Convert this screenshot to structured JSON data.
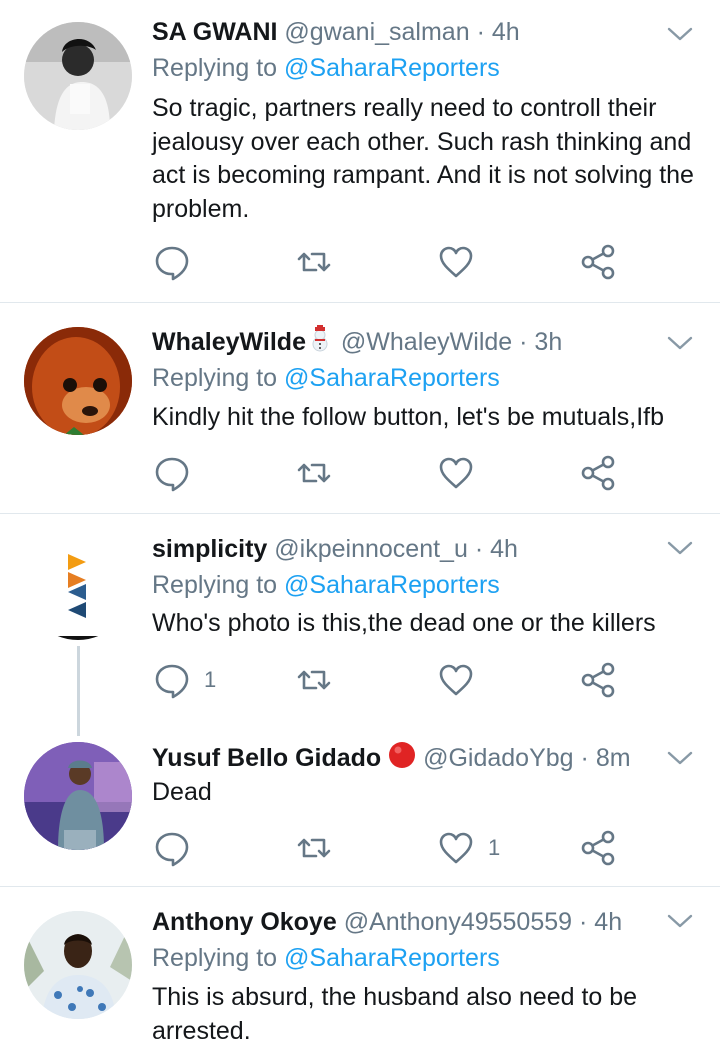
{
  "tweets": [
    {
      "name": "SA GWANI",
      "handle": "@gwani_salman",
      "time": "4h",
      "reply_prefix": "Replying to",
      "reply_to": "@SaharaReporters",
      "text": "So tragic, partners really need to controll their jealousy over each other. Such rash thinking and act is becoming rampant. And it is not solving the problem.",
      "reply_count": "",
      "like_count": ""
    },
    {
      "name": "WhaleyWilde",
      "name_emoji": "snowman-emoji",
      "handle": "@WhaleyWilde",
      "time": "3h",
      "reply_prefix": "Replying to",
      "reply_to": "@SaharaReporters",
      "text": "Kindly hit the follow button, let's be mutuals,Ifb",
      "reply_count": "",
      "like_count": ""
    },
    {
      "name": "simplicity",
      "handle": "@ikpeinnocent_u",
      "time": "4h",
      "reply_prefix": "Replying to",
      "reply_to": "@SaharaReporters",
      "text": "Who's photo is this,the dead one or the killers",
      "reply_count": "1",
      "like_count": ""
    },
    {
      "name": "Yusuf Bello Gidado",
      "name_emoji": "red-circle-emoji",
      "handle": "@GidadoYbg",
      "time": "8m",
      "text": "Dead",
      "reply_count": "",
      "like_count": "1"
    },
    {
      "name": "Anthony Okoye",
      "handle": "@Anthony49550559",
      "time": "4h",
      "reply_prefix": "Replying to",
      "reply_to": "@SaharaReporters",
      "text": "This is absurd, the husband also need to be arrested.",
      "reply_count": "",
      "like_count": ""
    }
  ],
  "separator_dot": "·",
  "colors": {
    "link": "#1da1f2",
    "secondary": "#657786",
    "text": "#14171a",
    "divider": "#e1e8ed",
    "thread_line": "#ccd6dd"
  }
}
